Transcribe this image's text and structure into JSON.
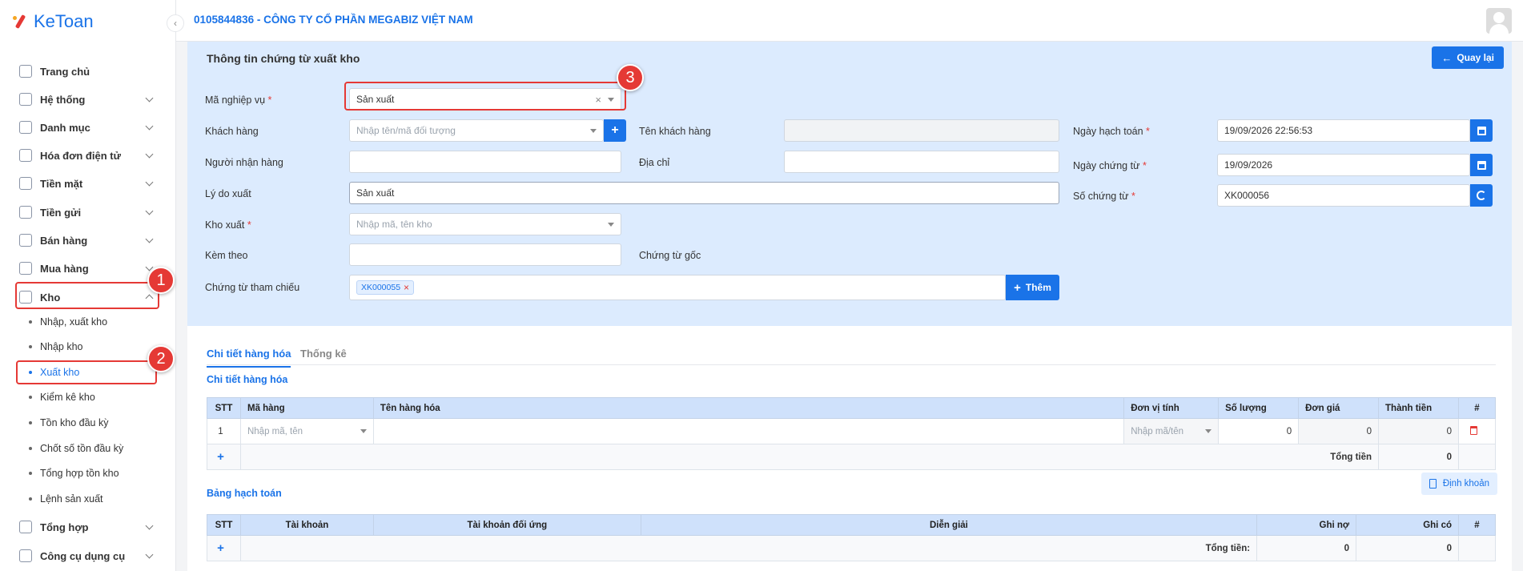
{
  "app": {
    "logo_text": "KeToan"
  },
  "header": {
    "company": "0105844836 - CÔNG TY CỔ PHẦN MEGABIZ VIỆT NAM"
  },
  "sidebar": {
    "items": [
      {
        "label": "Trang chủ"
      },
      {
        "label": "Hệ thống"
      },
      {
        "label": "Danh mục"
      },
      {
        "label": "Hóa đơn điện tử"
      },
      {
        "label": "Tiền mặt"
      },
      {
        "label": "Tiền gửi"
      },
      {
        "label": "Bán hàng"
      },
      {
        "label": "Mua hàng"
      },
      {
        "label": "Kho"
      },
      {
        "label": "Tổng hợp"
      },
      {
        "label": "Công cụ dụng cụ"
      }
    ],
    "kho_sub": [
      {
        "label": "Nhập, xuất kho"
      },
      {
        "label": "Nhập kho"
      },
      {
        "label": "Xuất kho"
      },
      {
        "label": "Kiểm kê kho"
      },
      {
        "label": "Tồn kho đầu kỳ"
      },
      {
        "label": "Chốt số tồn đầu kỳ"
      },
      {
        "label": "Tổng hợp tồn kho"
      },
      {
        "label": "Lệnh sản xuất"
      }
    ]
  },
  "annotations": [
    "1",
    "2",
    "3"
  ],
  "form": {
    "title": "Thông tin chứng từ xuất kho",
    "back_label": "Quay lại",
    "ma_nghiep_vu": {
      "label": "Mã nghiệp vụ",
      "value": "Sản xuất"
    },
    "khach_hang": {
      "label": "Khách hàng",
      "placeholder": "Nhập tên/mã đối tượng"
    },
    "ten_khach_hang": {
      "label": "Tên khách hàng",
      "value": ""
    },
    "ngay_hach_toan": {
      "label": "Ngày hạch toán",
      "value": "19/09/2026 22:56:53"
    },
    "nguoi_nhan_hang": {
      "label": "Người nhận hàng",
      "value": ""
    },
    "dia_chi": {
      "label": "Địa chỉ",
      "value": ""
    },
    "ngay_chung_tu": {
      "label": "Ngày chứng từ",
      "value": "19/09/2026"
    },
    "ly_do_xuat": {
      "label": "Lý do xuất",
      "value": "Sản xuất"
    },
    "so_chung_tu": {
      "label": "Số chứng từ",
      "value": "XK000056"
    },
    "kho_xuat": {
      "label": "Kho xuất",
      "placeholder": "Nhập mã, tên kho"
    },
    "kem_theo": {
      "label": "Kèm theo",
      "value": ""
    },
    "chung_tu_goc": {
      "label": "Chứng từ gốc"
    },
    "chung_tu_tham_chieu": {
      "label": "Chứng từ tham chiếu",
      "tags": [
        "XK000055"
      ],
      "add_label": "Thêm"
    }
  },
  "tabs": [
    {
      "label": "Chi tiết hàng hóa",
      "active": true
    },
    {
      "label": "Thống kê",
      "active": false
    }
  ],
  "goods": {
    "section_title": "Chi tiết hàng hóa",
    "columns": [
      "STT",
      "Mã hàng",
      "Tên hàng hóa",
      "Đơn vị tính",
      "Số lượng",
      "Đơn giá",
      "Thành tiền",
      "#"
    ],
    "rows": [
      {
        "stt": "1",
        "ma_hang_placeholder": "Nhập mã, tên",
        "ten_hang": "",
        "dvt_placeholder": "Nhập mã/tên",
        "so_luong": "0",
        "don_gia": "0",
        "thanh_tien": "0"
      }
    ],
    "add_symbol": "+",
    "total_label": "Tổng tiền",
    "total_value": "0"
  },
  "accounting": {
    "section_title": "Bảng hạch toán",
    "define_label": "Định khoản",
    "columns": [
      "STT",
      "Tài khoản",
      "Tài khoản đối ứng",
      "Diễn giải",
      "Ghi nợ",
      "Ghi có",
      "#"
    ],
    "add_symbol": "+",
    "total_label": "Tổng tiền:",
    "total_debit": "0",
    "total_credit": "0"
  },
  "colors": {
    "primary": "#1a73e8",
    "annotation": "#e53935",
    "form_bg": "#dcebfe"
  }
}
